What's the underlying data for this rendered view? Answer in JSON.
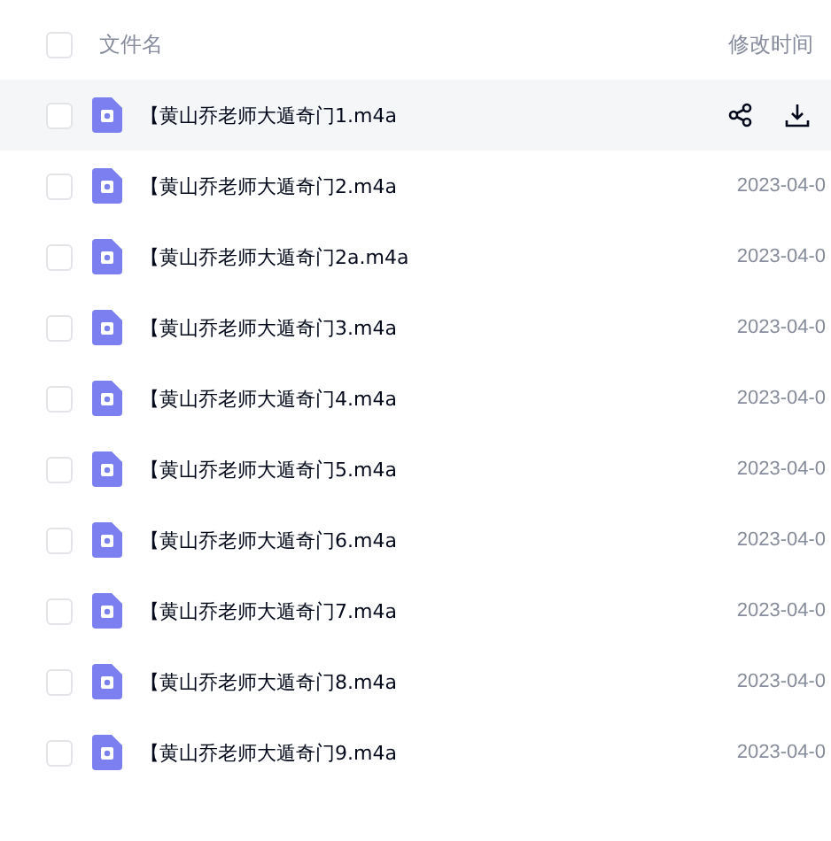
{
  "header": {
    "checked": false,
    "name_column": "文件名",
    "time_column": "修改时间"
  },
  "rows": [
    {
      "name": "【黄山乔老师大遁奇门1.m4a",
      "hovered": true,
      "checked": false
    },
    {
      "name": "【黄山乔老师大遁奇门2.m4a",
      "hovered": false,
      "checked": false,
      "modified": "2023-04-0"
    },
    {
      "name": "【黄山乔老师大遁奇门2a.m4a",
      "hovered": false,
      "checked": false,
      "modified": "2023-04-0"
    },
    {
      "name": "【黄山乔老师大遁奇门3.m4a",
      "hovered": false,
      "checked": false,
      "modified": "2023-04-0"
    },
    {
      "name": "【黄山乔老师大遁奇门4.m4a",
      "hovered": false,
      "checked": false,
      "modified": "2023-04-0"
    },
    {
      "name": "【黄山乔老师大遁奇门5.m4a",
      "hovered": false,
      "checked": false,
      "modified": "2023-04-0"
    },
    {
      "name": "【黄山乔老师大遁奇门6.m4a",
      "hovered": false,
      "checked": false,
      "modified": "2023-04-0"
    },
    {
      "name": "【黄山乔老师大遁奇门7.m4a",
      "hovered": false,
      "checked": false,
      "modified": "2023-04-0"
    },
    {
      "name": "【黄山乔老师大遁奇门8.m4a",
      "hovered": false,
      "checked": false,
      "modified": "2023-04-0"
    },
    {
      "name": "【黄山乔老师大遁奇门9.m4a",
      "hovered": false,
      "checked": false,
      "modified": "2023-04-0"
    }
  ]
}
